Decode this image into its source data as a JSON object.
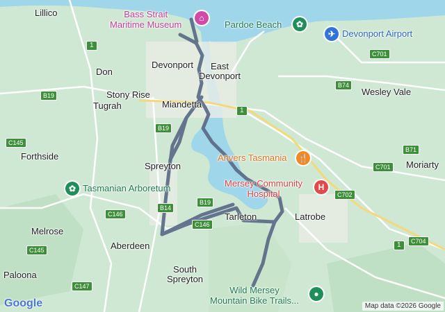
{
  "places": {
    "lillico": "Lillico",
    "devonport": "Devonport",
    "east_devonport": "East\nDevonport",
    "don": "Don",
    "stony_rise": "Stony Rise",
    "tugrah": "Tugrah",
    "miandetta": "Miandetta",
    "wesley_vale": "Wesley Vale",
    "forthside": "Forthside",
    "spreyton": "Spreyton",
    "moriarty": "Moriarty",
    "latrobe": "Latrobe",
    "tarleton": "Tarleton",
    "melrose": "Melrose",
    "aberdeen": "Aberdeen",
    "south_spreyton": "South\nSpreyton",
    "paloona": "Paloona"
  },
  "pois": {
    "bass_strait_museum": "Bass Strait\nMaritime Museum",
    "pardoe_beach": "Pardoe Beach",
    "devonport_airport": "Devonport Airport",
    "anvers": "Anvers Tasmania",
    "mersey_hospital": "Mersey Community\nHospital",
    "arboretum": "Tasmanian Arboretum",
    "wild_mersey": "Wild Mersey\nMountain Bike Trails..."
  },
  "road_shields": {
    "r1a": "1",
    "r1b": "1",
    "r1c": "1",
    "c701a": "C701",
    "c701b": "C701",
    "b74": "B74",
    "b19a": "B19",
    "b19b": "B19",
    "b19c": "B19",
    "b14": "B14",
    "c145a": "C145",
    "c145b": "C145",
    "c146a": "C146",
    "c146b": "C146",
    "c147": "C147",
    "b71": "B71",
    "c702": "C702",
    "c704": "C704"
  },
  "footer": {
    "google": "Google",
    "attribution": "Map data ©2026 Google"
  },
  "colors": {
    "water": "#9fd6ea",
    "land": "#cfe8d3",
    "route": "#5a6b87",
    "poi_museum": "#d04aa8",
    "poi_green": "#1e8e5a",
    "poi_airport": "#2f74d8",
    "poi_food": "#f08a24",
    "poi_hospital": "#e04a4a"
  }
}
